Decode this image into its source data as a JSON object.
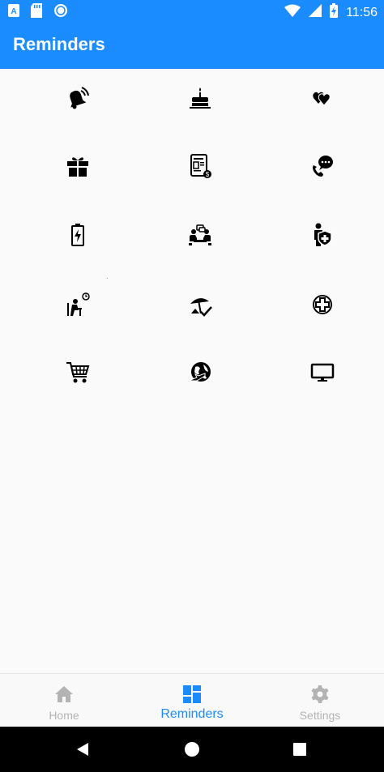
{
  "status_bar": {
    "time": "11:56",
    "left_icons": [
      "font-a-icon",
      "sd-card-icon",
      "circle-notification-icon"
    ],
    "right_icons": [
      "wifi-icon",
      "signal-icon",
      "battery-charging-icon"
    ]
  },
  "app_bar": {
    "title": "Reminders"
  },
  "reminders": {
    "items": [
      {
        "icon": "bell-ringing-icon"
      },
      {
        "icon": "birthday-cake-icon"
      },
      {
        "icon": "hearts-icon"
      },
      {
        "icon": "gift-icon"
      },
      {
        "icon": "invoice-bill-icon"
      },
      {
        "icon": "phone-chat-icon"
      },
      {
        "icon": "battery-charge-icon"
      },
      {
        "icon": "meeting-icon"
      },
      {
        "icon": "insurance-person-icon"
      },
      {
        "icon": "waiting-person-icon"
      },
      {
        "icon": "beach-umbrella-icon"
      },
      {
        "icon": "medical-cross-icon"
      },
      {
        "icon": "shopping-cart-icon"
      },
      {
        "icon": "travel-globe-icon"
      },
      {
        "icon": "monitor-icon"
      }
    ]
  },
  "tabs": [
    {
      "label": "Home",
      "icon": "home-icon",
      "active": false
    },
    {
      "label": "Reminders",
      "icon": "dashboard-icon",
      "active": true
    },
    {
      "label": "Settings",
      "icon": "gear-icon",
      "active": false
    }
  ],
  "colors": {
    "primary": "#1a8cff",
    "inactive_tab": "#b3b3b3",
    "background": "#fafafa"
  }
}
